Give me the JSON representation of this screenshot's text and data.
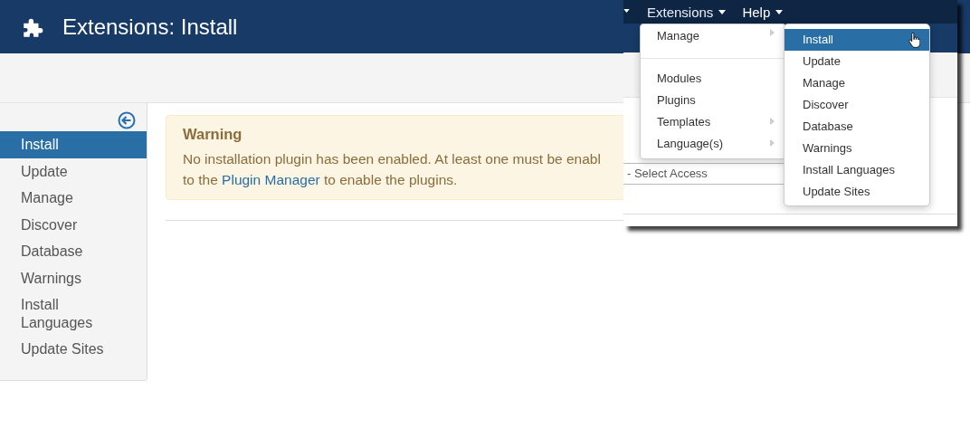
{
  "header": {
    "title": "Extensions: Install"
  },
  "sidebar": {
    "items": [
      {
        "label": "Install",
        "selected": true
      },
      {
        "label": "Update",
        "selected": false
      },
      {
        "label": "Manage",
        "selected": false
      },
      {
        "label": "Discover",
        "selected": false
      },
      {
        "label": "Database",
        "selected": false
      },
      {
        "label": "Warnings",
        "selected": false
      },
      {
        "label": "Install Languages",
        "selected": false
      },
      {
        "label": "Update Sites",
        "selected": false
      }
    ]
  },
  "warning": {
    "title": "Warning",
    "line_1": "No installation plugin has been enabled. At least one must be enabl",
    "before_link": "to the ",
    "link": "Plugin Manager",
    "after_link": " to enable the plugins."
  },
  "inset": {
    "menu_bar": [
      {
        "label": "Extensions",
        "open": true
      },
      {
        "label": "Help",
        "open": false
      }
    ],
    "select_field": {
      "value": "- Select Access"
    },
    "extensions_menu": [
      {
        "label": "Manage",
        "submenu": true,
        "divider_after": true
      },
      {
        "label": "Modules",
        "submenu": false,
        "divider_after": false
      },
      {
        "label": "Plugins",
        "submenu": false,
        "divider_after": false
      },
      {
        "label": "Templates",
        "submenu": true,
        "divider_after": false
      },
      {
        "label": "Language(s)",
        "submenu": true,
        "divider_after": false
      }
    ],
    "manage_menu": [
      {
        "label": "Install",
        "selected": true
      },
      {
        "label": "Update",
        "selected": false
      },
      {
        "label": "Manage",
        "selected": false
      },
      {
        "label": "Discover",
        "selected": false
      },
      {
        "label": "Database",
        "selected": false
      },
      {
        "label": "Warnings",
        "selected": false
      },
      {
        "label": "Install Languages",
        "selected": false
      },
      {
        "label": "Update Sites",
        "selected": false
      }
    ]
  }
}
